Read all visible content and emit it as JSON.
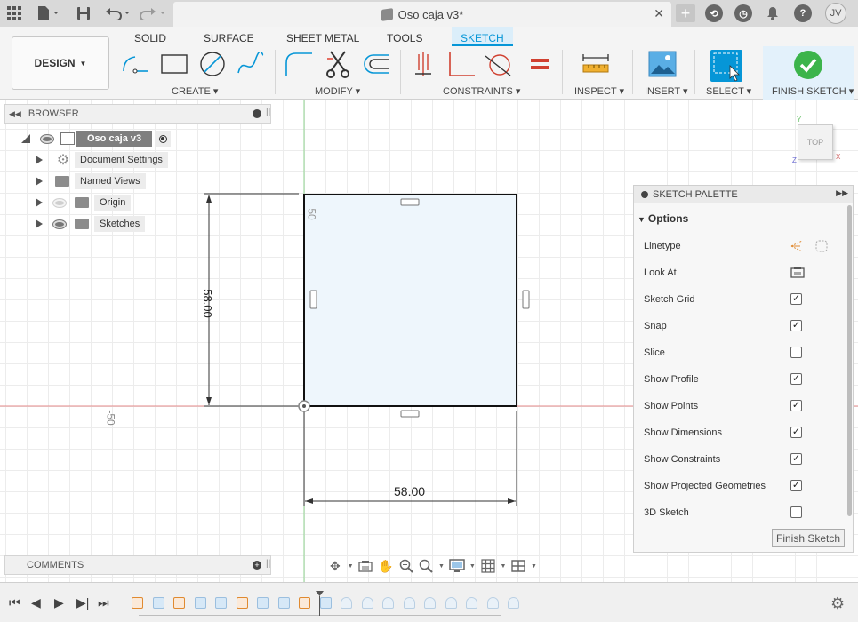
{
  "app": {
    "document_title": "Oso caja v3*",
    "user_initials": "JV"
  },
  "ribbon": {
    "workspace": "DESIGN",
    "tabs": [
      "SOLID",
      "SURFACE",
      "SHEET METAL",
      "TOOLS",
      "SKETCH"
    ],
    "active_tab": "SKETCH",
    "groups": {
      "create": "CREATE",
      "modify": "MODIFY",
      "constraints": "CONSTRAINTS",
      "inspect": "INSPECT",
      "insert": "INSERT",
      "select": "SELECT",
      "finish": "FINISH SKETCH"
    }
  },
  "browser": {
    "title": "BROWSER",
    "root": "Oso caja v3",
    "items": [
      "Document Settings",
      "Named Views",
      "Origin",
      "Sketches"
    ]
  },
  "comments": {
    "title": "COMMENTS"
  },
  "canvas": {
    "dim_vertical": "58.00",
    "dim_horizontal": "58.00",
    "ruler_50": "50",
    "ruler_neg50": "-50",
    "viewcube": "TOP",
    "axis_y": "Y",
    "axis_z": "Z",
    "axis_x": "X"
  },
  "palette": {
    "title": "SKETCH PALETTE",
    "section": "Options",
    "options": [
      {
        "label": "Linetype",
        "kind": "icons"
      },
      {
        "label": "Look At",
        "kind": "icon"
      },
      {
        "label": "Sketch Grid",
        "checked": true
      },
      {
        "label": "Snap",
        "checked": true
      },
      {
        "label": "Slice",
        "checked": false
      },
      {
        "label": "Show Profile",
        "checked": true
      },
      {
        "label": "Show Points",
        "checked": true
      },
      {
        "label": "Show Dimensions",
        "checked": true
      },
      {
        "label": "Show Constraints",
        "checked": true
      },
      {
        "label": "Show Projected Geometries",
        "checked": true
      },
      {
        "label": "3D Sketch",
        "checked": false
      }
    ],
    "finish_button": "Finish Sketch"
  },
  "colors": {
    "accent": "#0696d7",
    "finish_green": "#3cb44b",
    "sketch_fill": "#eef6fc",
    "x_axis": "#e58a8a",
    "y_axis": "#8fd38f"
  }
}
